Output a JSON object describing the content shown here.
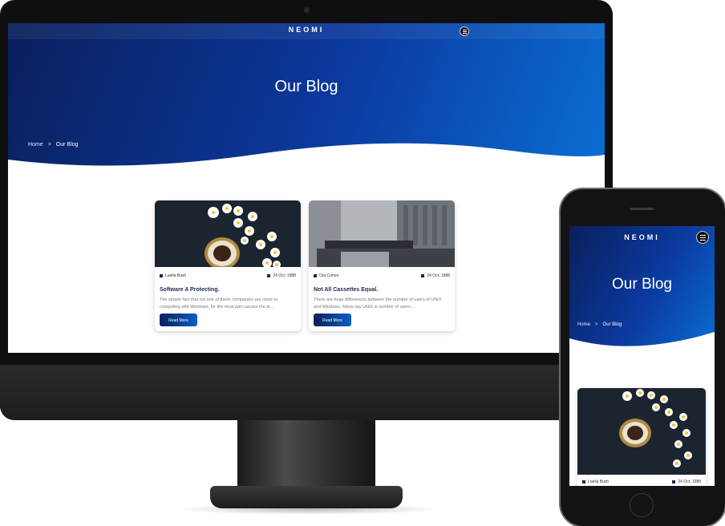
{
  "site": {
    "logo": "NEOMI",
    "hero_title": "Our Blog"
  },
  "breadcrumb": {
    "home": "Home",
    "separator": ">",
    "current": "Our Blog"
  },
  "posts": [
    {
      "author": "Luella Bush",
      "date": "24 Oct. 1988",
      "title": "Software A Protecting.",
      "excerpt": "The simple fact that not one of these companies are close to competing with Windows, for the most part causes the di...",
      "button": "Read More",
      "image": "daisies-and-coffee-cup"
    },
    {
      "author": "Ora Cohen",
      "date": "24 Oct. 1988",
      "title": "Not All Cassettes Equal.",
      "excerpt": "There are huge differences between the number of users of UNIX and Windows. Many say UNIX is number of users...",
      "button": "Read More",
      "image": "city-building-facade"
    }
  ],
  "mobile": {
    "logo": "NEOMI",
    "hero_title": "Our Blog",
    "breadcrumb_home": "Home",
    "breadcrumb_current": "Our Blog",
    "post": {
      "author": "Luella Bush",
      "date": "24 Oct. 1988",
      "image": "daisies-and-coffee-cup"
    }
  },
  "colors": {
    "hero_dark": "#0a1f5c",
    "hero_light": "#0a6fd4",
    "device_frame": "#0f0f10"
  }
}
